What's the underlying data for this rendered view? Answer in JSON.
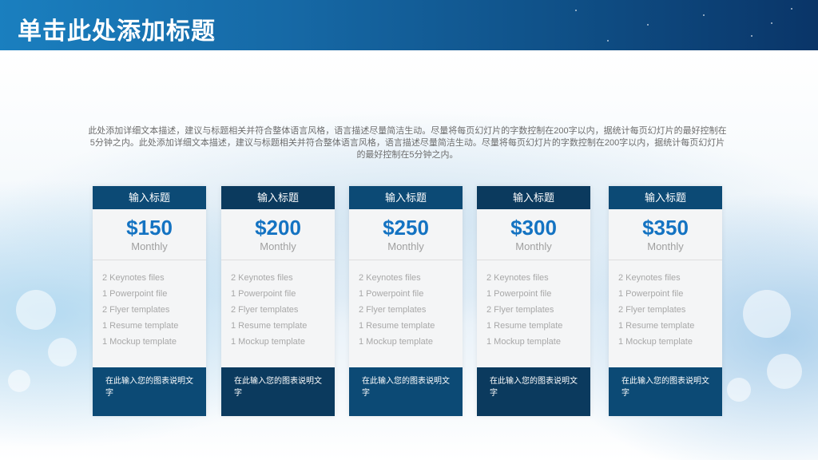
{
  "slide": {
    "title": "单击此处添加标题",
    "description": "此处添加详细文本描述，建议与标题相关并符合整体语言风格，语言描述尽量简洁生动。尽量将每页幻灯片的字数控制在200字以内，据统计每页幻灯片的最好控制在5分钟之内。此处添加详细文本描述，建议与标题相关并符合整体语言风格，语言描述尽量简洁生动。尽量将每页幻灯片的字数控制在200字以内，据统计每页幻灯片的最好控制在5分钟之内。"
  },
  "colors": {
    "header_blue": "#1669a6",
    "card_head_blue": "#0c4a75",
    "price_blue": "#1473c2",
    "feature_gray": "#a8a8a8"
  },
  "plans": [
    {
      "heading": "输入标题",
      "price": "$150",
      "period": "Monthly",
      "features": [
        "2 Keynotes files",
        "1 Powerpoint file",
        "2 Flyer templates",
        "1 Resume template",
        "1 Mockup template"
      ],
      "footer": "在此输入您的图表说明文字"
    },
    {
      "heading": "输入标题",
      "price": "$200",
      "period": "Monthly",
      "features": [
        "2 Keynotes files",
        "1 Powerpoint file",
        "2 Flyer templates",
        "1 Resume template",
        "1 Mockup template"
      ],
      "footer": "在此输入您的图表说明文字"
    },
    {
      "heading": "输入标题",
      "price": "$250",
      "period": "Monthly",
      "features": [
        "2 Keynotes files",
        "1 Powerpoint file",
        "2 Flyer templates",
        "1 Resume template",
        "1 Mockup template"
      ],
      "footer": "在此输入您的图表说明文字"
    },
    {
      "heading": "输入标题",
      "price": "$300",
      "period": "Monthly",
      "features": [
        "2 Keynotes files",
        "1 Powerpoint file",
        "2 Flyer templates",
        "1 Resume template",
        "1 Mockup template"
      ],
      "footer": "在此输入您的图表说明文字"
    },
    {
      "heading": "输入标题",
      "price": "$350",
      "period": "Monthly",
      "features": [
        "2 Keynotes files",
        "1 Powerpoint file",
        "2 Flyer templates",
        "1 Resume template",
        "1 Mockup template"
      ],
      "footer": "在此输入您的图表说明文字"
    }
  ]
}
